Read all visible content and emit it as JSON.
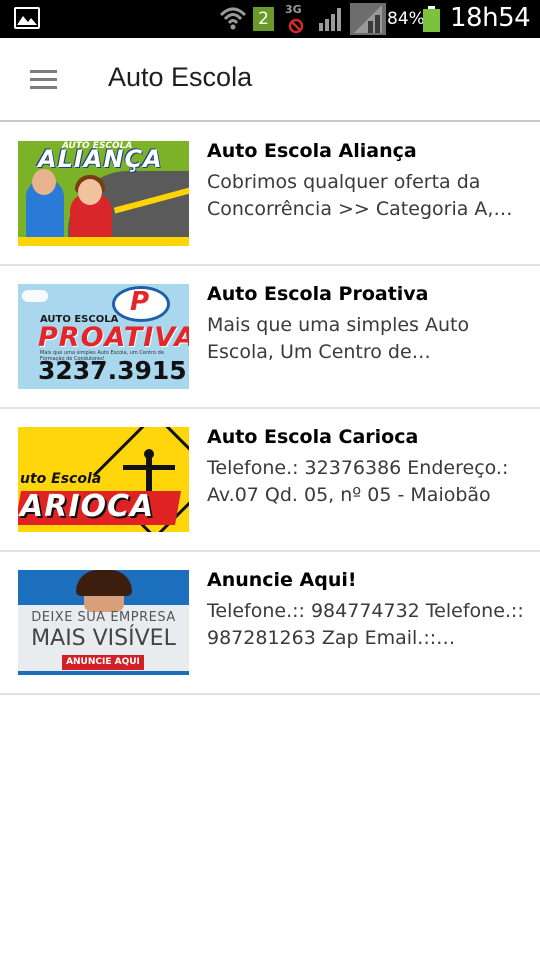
{
  "status_bar": {
    "sim_slot": "2",
    "network_type": "3G",
    "battery_percent": "84%",
    "battery_level": 0.84,
    "time": "18h54",
    "icons": [
      "gallery-icon",
      "wifi-icon",
      "sim-icon",
      "no-data-icon",
      "signal-icon",
      "signal-icon",
      "battery-icon"
    ]
  },
  "toolbar": {
    "title": "Auto Escola",
    "menu_icon": "hamburger-menu-icon"
  },
  "colors": {
    "status_bar_bg": "#000000",
    "toolbar_bg": "#ffffff",
    "battery": "#7cc23a",
    "divider": "#e2e2e2"
  },
  "listings": [
    {
      "title": "Auto Escola Aliança",
      "description": "Cobrimos qualquer oferta da Concorrência >> Categoria A,B e…",
      "image": {
        "brand_small": "AUTO ESCOLA",
        "brand": "ALIANÇA"
      }
    },
    {
      "title": "Auto Escola Proativa",
      "description": "Mais que uma simples Auto Escola, Um Centro de Formação…",
      "image": {
        "logo": "P",
        "brand_small": "AUTO ESCOLA",
        "brand": "PROATIVA",
        "tagline": "Mais que uma simples Auto Escola, um Centro de Formação de Condutores!",
        "phone": "3237.3915"
      }
    },
    {
      "title": "Auto Escola Carioca",
      "description": "Telefone.: 32376386 Endereço.: Av.07 Qd. 05, nº 05 - Maiobão",
      "image": {
        "brand_small": "uto Escola",
        "brand": "ARIOCA"
      }
    },
    {
      "title": "Anuncie Aqui!",
      "description": "Telefone.:: 984774732 Telefone.:: 987281263 Zap Email.::…",
      "image": {
        "line1": "DEIXE SUA EMPRESA",
        "line2": "MAIS VISÍVEL",
        "cta": "ANUNCIE AQUI"
      }
    }
  ]
}
